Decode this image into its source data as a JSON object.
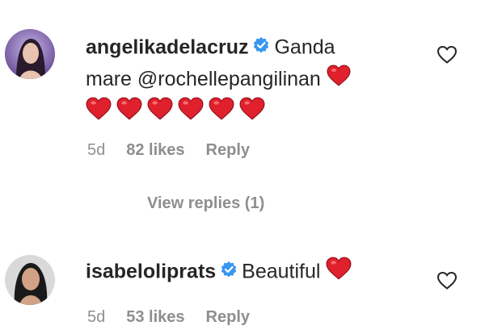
{
  "comments": [
    {
      "username": "angelikadelacruz",
      "text_prefix": "Ganda",
      "text_line2": "mare",
      "mention": "@rochellepangilinan",
      "time": "5d",
      "likes": "82 likes",
      "reply": "Reply",
      "view_replies": "View replies (1)"
    },
    {
      "username": "isabeloliprats",
      "text": "Beautiful",
      "time": "5d",
      "likes": "53 likes",
      "reply": "Reply"
    }
  ],
  "colors": {
    "heart": "#e0202d",
    "verified": "#3897f0",
    "muted": "#8e8e8e"
  },
  "icons": {
    "verified": "verified-badge-icon",
    "heart_emoji": "red-heart-emoji-icon",
    "like": "heart-outline-icon"
  }
}
